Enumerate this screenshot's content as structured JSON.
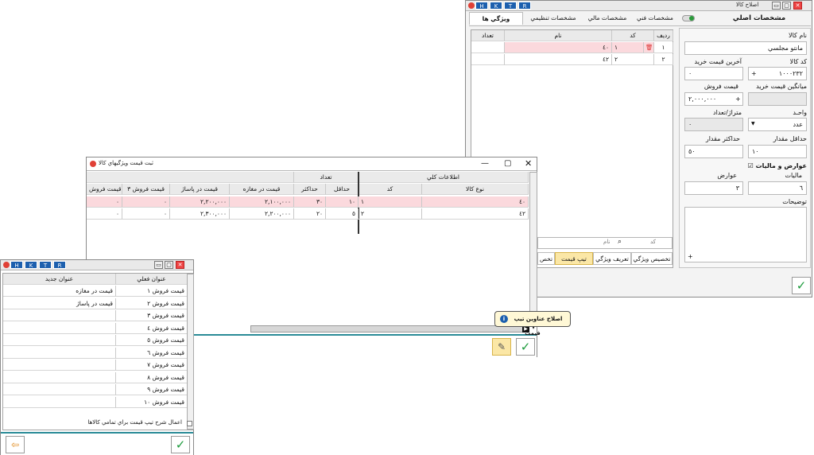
{
  "item_window": {
    "title": "اصلاح كالا",
    "title_buttons": [
      "H",
      "K",
      "T",
      "R"
    ],
    "side_tabs": {
      "main": "مشخصات اصلي",
      "technical": "مشخصات فني",
      "financial": "مشخصات مالي",
      "settings": "مشخصات تنظيمي",
      "attributes": "ويژگي ها"
    },
    "name_label": "نام كالا",
    "name_value": "مانتو مجلسي",
    "code_label": "كد كالا",
    "code_value": "١٠٠٠٢٣٢",
    "last_price_label": "آخرين قيمت خريد",
    "last_price_value": "٠",
    "sale_price_label": "قيمت فروش",
    "sale_price_value": "٢,٠٠٠,٠٠٠",
    "avg_price_label": "ميانگين قيمت خريد",
    "unit_label": "واحـد",
    "unit_value": "عدد",
    "meter_label": "متراژ/تعداد",
    "meter_value": "٠",
    "min_label": "حداقل مقدار",
    "min_value": "١٠",
    "max_label": "حداكثر مقدار",
    "max_value": "٥٠",
    "tax_check_label": "عوارض و ماليات",
    "tax_label": "ماليات",
    "tax_value": "٦",
    "duty_label": "عوارض",
    "duty_value": "٣",
    "desc_label": "توضيحات",
    "attr_grid": {
      "headers": {
        "row": "رديف",
        "code": "كد",
        "name": "نام",
        "qty": "تعداد"
      },
      "rows": [
        {
          "row": "١",
          "code": "١",
          "name": "٤٠",
          "qty": ""
        },
        {
          "row": "٢",
          "code": "٢",
          "name": "٤٢",
          "qty": ""
        }
      ]
    }
  },
  "price_window": {
    "title": "ثبت قيمت ويژگيهاي كالا",
    "group_general": "اطلاعات كلي",
    "group_qty": "تعداد",
    "headers": {
      "type": "نوع كالا",
      "code": "كد",
      "min": "حداقل",
      "max": "حداكثر",
      "store": "قيمت در مغازه",
      "pasaj": "قيمت در پاساژ",
      "sale3": "قيمت فروش ٣",
      "sale4": "قيمت فروش"
    },
    "rows": [
      {
        "type": "٤٠",
        "code": "١",
        "min": "١٠",
        "max": "٣٠",
        "store": "٢,١٠٠,٠٠٠",
        "pasaj": "٢,٢٠٠,٠٠٠",
        "sale3": "٠",
        "sale4": "٠"
      },
      {
        "type": "٤٢",
        "code": "٢",
        "min": "٥",
        "max": "٢٠",
        "store": "٢,٢٠٠,٠٠٠",
        "pasaj": "٢,٣٠٠,٠٠٠",
        "sale3": "٠",
        "sale4": "٠"
      }
    ],
    "search_code_ph": "كد",
    "search_name_ph": "نام",
    "bottom_tabs": [
      "تخصيص ويژگي",
      "تعريف ويژگي",
      "تيپ قيمت",
      "تخص"
    ],
    "tooltip": "اصلاح عناوين تيپ قيمت"
  },
  "titles_window": {
    "title_buttons": [
      "H",
      "K",
      "T",
      "R"
    ],
    "col_current": "عنوان فعلي",
    "col_new": "عنوان جديد",
    "rows": [
      {
        "current": "قيمت فروش ١",
        "new": "قيمت در مغازه"
      },
      {
        "current": "قيمت فروش ٢",
        "new": "قيمت در پاساژ"
      },
      {
        "current": "قيمت فروش ٣",
        "new": ""
      },
      {
        "current": "قيمت فروش ٤",
        "new": ""
      },
      {
        "current": "قيمت فروش ٥",
        "new": ""
      },
      {
        "current": "قيمت فروش ٦",
        "new": ""
      },
      {
        "current": "قيمت فروش ٧",
        "new": ""
      },
      {
        "current": "قيمت فروش ٨",
        "new": ""
      },
      {
        "current": "قيمت فروش ٩",
        "new": ""
      },
      {
        "current": "قيمت فروش ١٠",
        "new": ""
      }
    ],
    "apply_all_label": "اعمال شرح تيپ قيمت براي تمامي كالاها"
  }
}
